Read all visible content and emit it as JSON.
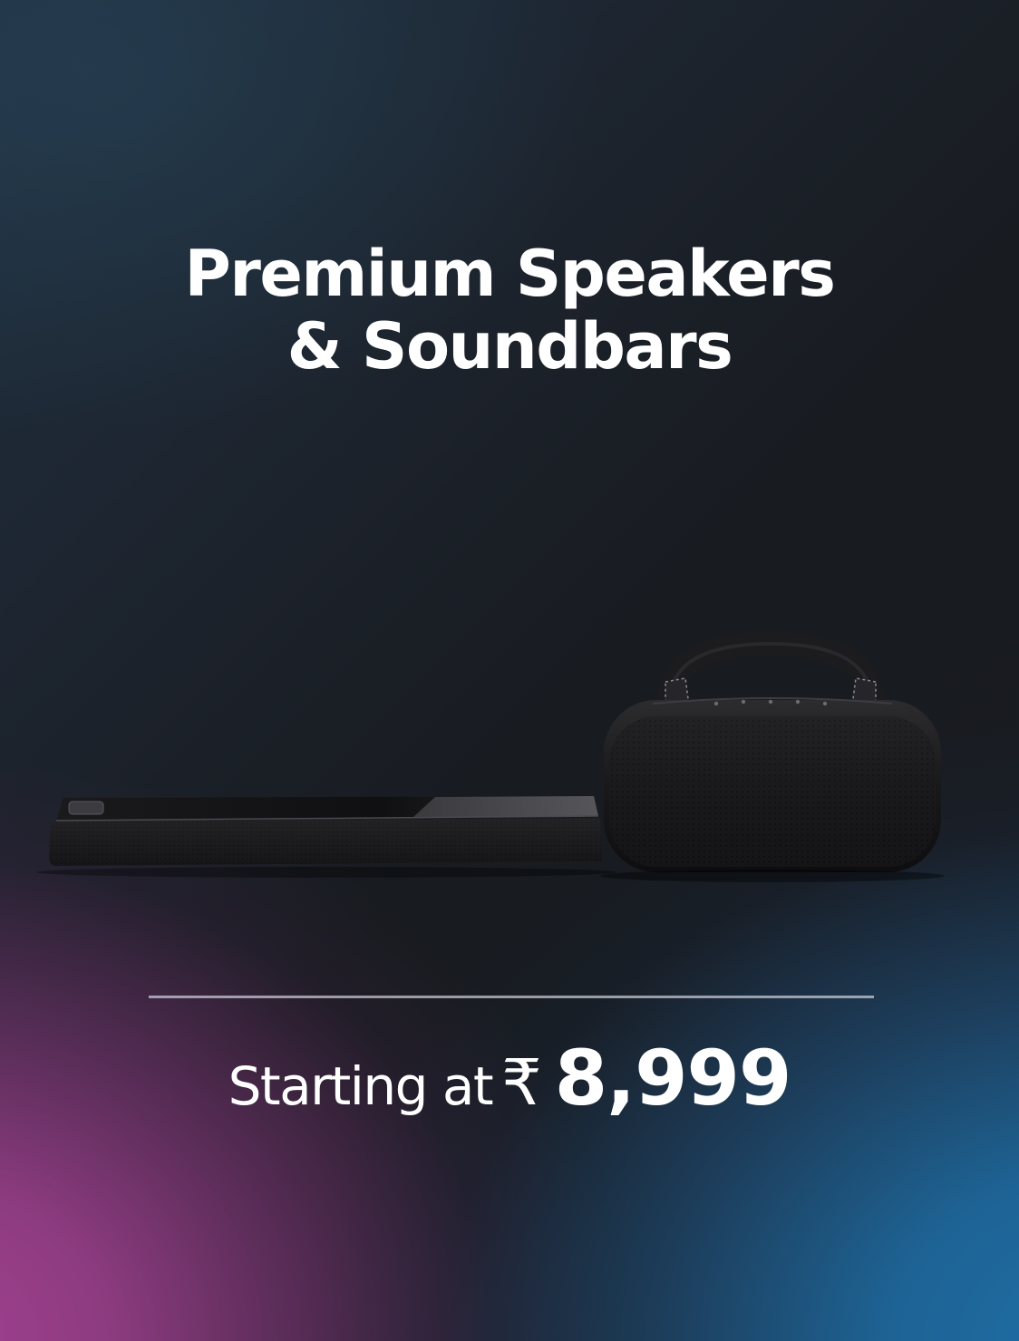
{
  "banner": {
    "headline_line1": "Premium Speakers",
    "headline_line2": "& Soundbars",
    "price_prefix": "Starting at",
    "currency_symbol": "₹",
    "price_value": "8,999"
  },
  "colors": {
    "background_top": "#1c222b",
    "gradient_pink": "#a24191",
    "gradient_blue": "#1e6fa8",
    "text": "#ffffff",
    "divider": "#d2d2dc"
  },
  "products": {
    "soundbar_icon": "soundbar-icon",
    "speaker_icon": "portable-speaker-icon"
  }
}
